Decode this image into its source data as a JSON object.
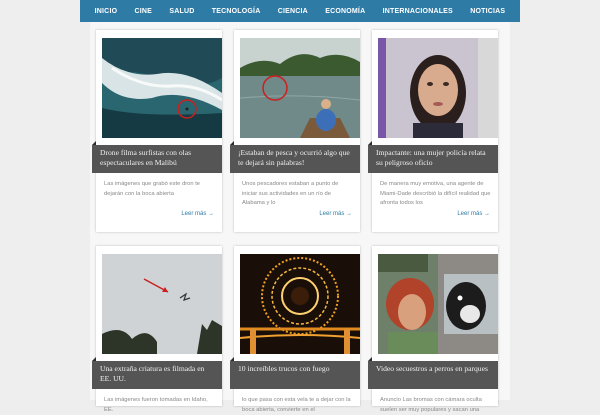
{
  "nav": {
    "items": [
      "INICIO",
      "CINE",
      "SALUD",
      "TECNOLOGÍA",
      "CIENCIA",
      "ECONOMÍA",
      "INTERNACIONALES",
      "NOTICIAS"
    ]
  },
  "cards": [
    {
      "title": "Drone filma surfistas con olas espectaculares en Malibú",
      "excerpt": "Las imágenes que grabó este dron te dejarán con la boca abierta",
      "read_more": "Leer más →"
    },
    {
      "title": "¡Estaban de pesca y ocurrió algo que te dejará sin palabras!",
      "excerpt": "Unos pescadores estaban a punto de iniciar sus actividades en un río de Alabama y lo",
      "read_more": "Leer más →"
    },
    {
      "title": "Impactante: una mujer policía relata su peligroso oficio",
      "excerpt": "De manera muy emotiva, una agente de Miami-Dade describió la difícil realidad que afronta todos los",
      "read_more": "Leer más →"
    },
    {
      "title": "Una extraña criatura es filmada en EE. UU.",
      "excerpt": "Las imágenes fueron tomadas en Idaho, EE.",
      "read_more": ""
    },
    {
      "title": "10 increíbles trucos con fuego",
      "excerpt": "lo que pasa con esta vela te a dejar con la boca abierta, convierte en el",
      "read_more": ""
    },
    {
      "title": "Video secuestros a perros en parques",
      "excerpt": "Anuncio Las bromas con cámara oculta suelen ser muy populares y sacan una",
      "read_more": ""
    }
  ],
  "colors": {
    "nav_bg": "#2e7ba6",
    "title_bar_bg": "#555555",
    "link": "#2e7ba6"
  }
}
